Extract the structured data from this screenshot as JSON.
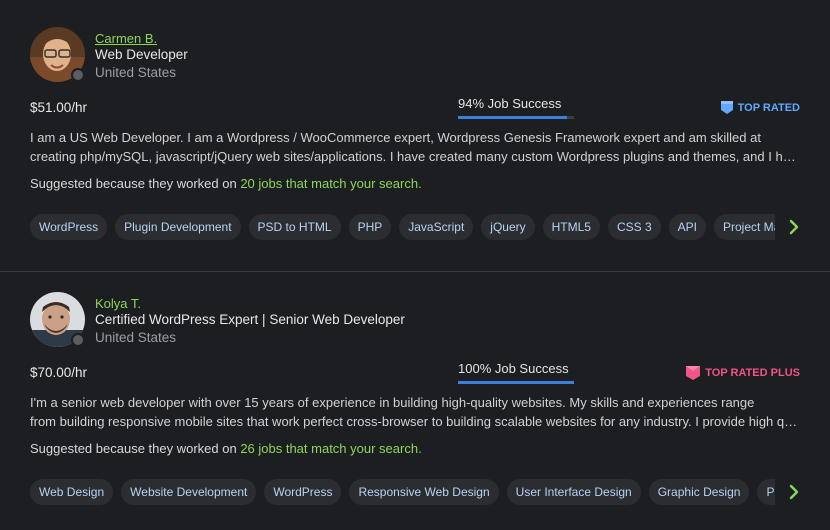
{
  "freelancers": [
    {
      "name": "Carmen B.",
      "title": "Web Developer",
      "location": "United States",
      "rate": "$51.00/hr",
      "job_success": "94% Job Success",
      "job_success_value": 94,
      "badge": "TOP RATED",
      "description_line1": "I am a US Web Developer. I am a Wordpress / WooCommerce expert, Wordpress Genesis Framework expert and am skilled at",
      "description_line2": "creating php/mySQL, javascript/jQuery web sites/applications. I have created many custom Wordpress plugins and themes, and I have developed many custom CMS systems and web applications for clients.",
      "suggested_prefix": "Suggested because they worked on ",
      "suggested_link": "20 jobs that match your search.",
      "skills": [
        "WordPress",
        "Plugin Development",
        "PSD to HTML",
        "PHP",
        "JavaScript",
        "jQuery",
        "HTML5",
        "CSS 3",
        "API",
        "Project Management"
      ]
    },
    {
      "name": "Kolya T.",
      "title": "Certified WordPress Expert | Senior Web Developer",
      "location": "United States",
      "rate": "$70.00/hr",
      "job_success": "100% Job Success",
      "job_success_value": 100,
      "badge": "TOP RATED PLUS",
      "description_line1": "I'm a senior web developer with over 15 years of experience in building high-quality websites. My skills and experiences range",
      "description_line2": "from building responsive mobile sites that work perfect cross-browser to building scalable websites for any industry. I provide high quality work and communication.",
      "suggested_prefix": "Suggested because they worked on ",
      "suggested_link": "26 jobs that match your search.",
      "skills": [
        "Web Design",
        "Website Development",
        "WordPress",
        "Responsive Web Design",
        "User Interface Design",
        "Graphic Design",
        "PSD to HTML"
      ]
    }
  ],
  "colors": {
    "accent_green": "#8cd65a",
    "progress_blue": "#3d7fe0",
    "top_rated": "#62a8ff",
    "top_rated_plus": "#f25388"
  },
  "icons": {
    "top_rated": "shield-badge-icon",
    "top_rated_plus": "shield-badge-icon",
    "next": "chevron-right-icon"
  }
}
